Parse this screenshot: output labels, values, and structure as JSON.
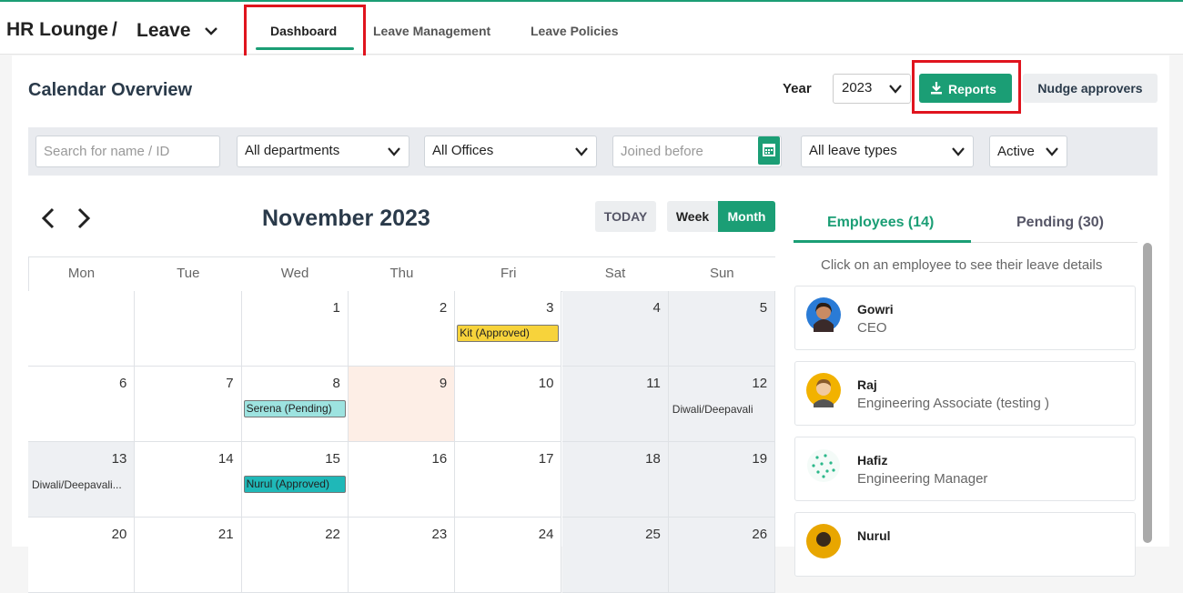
{
  "header": {
    "crumb_app": "HR Lounge",
    "crumb_sep": "/",
    "crumb_module": "Leave",
    "tabs": [
      "Dashboard",
      "Leave Management",
      "Leave Policies"
    ]
  },
  "toolbar": {
    "title": "Calendar Overview",
    "year_label": "Year",
    "year_value": "2023",
    "reports_label": "Reports",
    "nudge_label": "Nudge approvers"
  },
  "filters": {
    "search_placeholder": "Search for name / ID",
    "department": "All departments",
    "office": "All Offices",
    "joined_placeholder": "Joined before",
    "leave_type": "All leave types",
    "status": "Active"
  },
  "calendar": {
    "month_title": "November 2023",
    "today_label": "TODAY",
    "week_label": "Week",
    "month_label": "Month",
    "days_of_week": [
      "Mon",
      "Tue",
      "Wed",
      "Thu",
      "Fri",
      "Sat",
      "Sun"
    ],
    "weeks": [
      [
        "",
        "",
        "1",
        "2",
        "3",
        "4",
        "5"
      ],
      [
        "6",
        "7",
        "8",
        "9",
        "10",
        "11",
        "12"
      ],
      [
        "13",
        "14",
        "15",
        "16",
        "17",
        "18",
        "19"
      ],
      [
        "20",
        "21",
        "22",
        "23",
        "24",
        "25",
        "26"
      ]
    ],
    "events": [
      {
        "week": 0,
        "day": 4,
        "label": "Kit (Approved)",
        "color": "#f7d33b"
      },
      {
        "week": 1,
        "day": 2,
        "label": "Serena (Pending)",
        "color": "#9de3e0"
      },
      {
        "week": 2,
        "day": 2,
        "label": "Nurul (Approved)",
        "color": "#1fb8b8"
      }
    ],
    "holidays": [
      {
        "week": 1,
        "day": 6,
        "label": "Diwali/Deepavali"
      },
      {
        "week": 2,
        "day": 0,
        "label": "Diwali/Deepavali..."
      }
    ]
  },
  "panel": {
    "tab_employees": "Employees (14)",
    "tab_pending": "Pending (30)",
    "hint": "Click on an employee to see their leave details",
    "employees": [
      {
        "name": "Gowri",
        "role": "CEO"
      },
      {
        "name": "Raj",
        "role": "Engineering Associate (testing )"
      },
      {
        "name": "Hafiz",
        "role": "Engineering Manager"
      },
      {
        "name": "Nurul",
        "role": ""
      }
    ]
  },
  "colors": {
    "accent": "#1b9e75",
    "highlight_box": "#e0141e",
    "today_cell": "#fdeee6",
    "weekend_cell": "#eef0f3"
  }
}
